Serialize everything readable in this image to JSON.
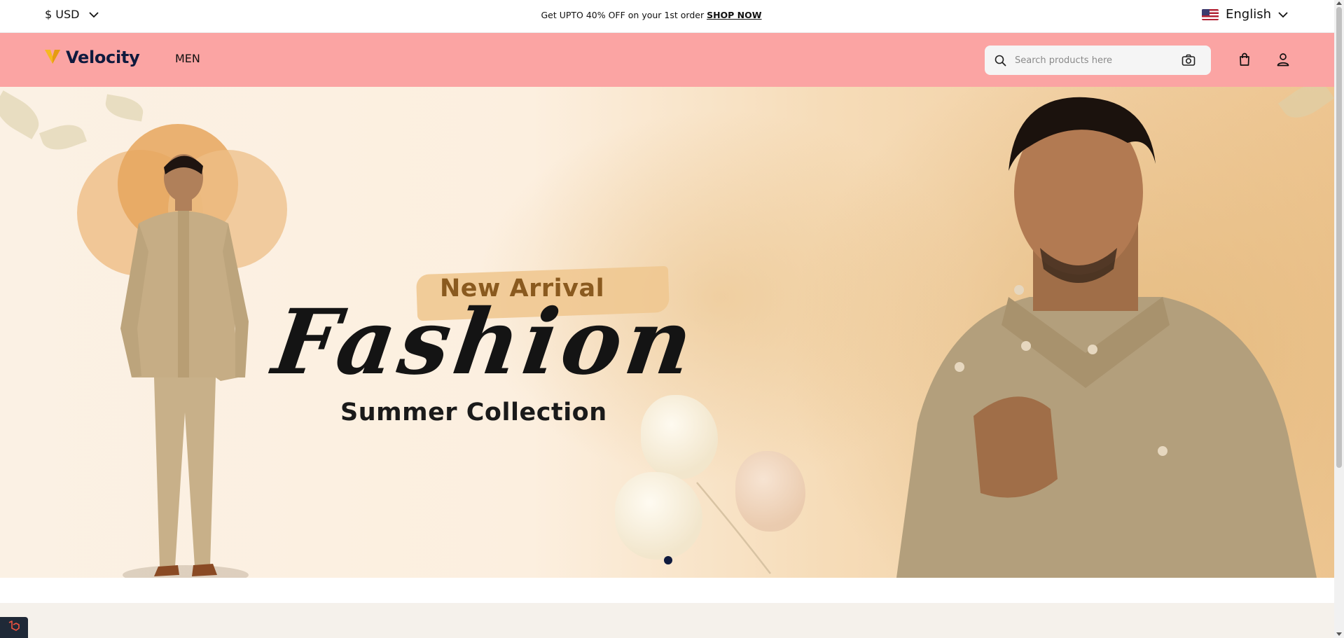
{
  "topbar": {
    "currency_label": "$ USD",
    "promo_text": "Get UPTO 40% OFF on your 1st order ",
    "promo_link": "SHOP NOW",
    "language_label": "English"
  },
  "header": {
    "brand": "Velocity",
    "nav_items": [
      "MEN"
    ],
    "search_placeholder": "Search products here"
  },
  "hero": {
    "headline_small": "New Arrival",
    "headline_script": "Fashion",
    "headline_sub": "Summer Collection",
    "slides_total": 1,
    "active_slide": 1
  },
  "colors": {
    "header_bg": "#fba4a3",
    "brand_navy": "#0f1a3e",
    "brand_yellow": "#f5b921",
    "accent_brown": "#8a5a1f"
  },
  "icons": [
    "chevron-down-icon",
    "us-flag-icon",
    "velocity-logo-icon",
    "search-icon",
    "camera-icon",
    "shopping-bag-icon",
    "user-icon",
    "laravel-icon"
  ]
}
